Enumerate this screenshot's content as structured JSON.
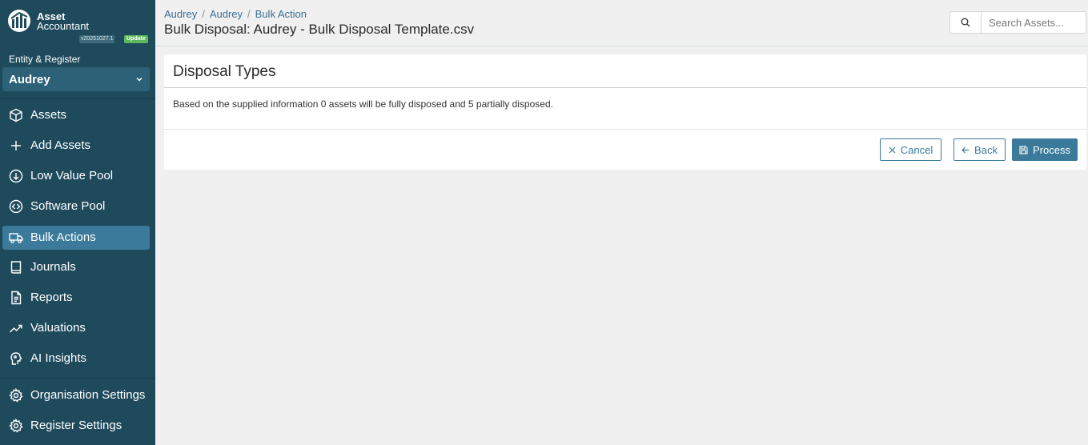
{
  "brand": {
    "name": "Asset",
    "subtitle": "Accountant",
    "version": "v20251027.1",
    "update_label": "Update"
  },
  "entity": {
    "label": "Entity & Register",
    "selected": "Audrey"
  },
  "nav": {
    "items": [
      {
        "label": "Assets",
        "icon": "cube-icon"
      },
      {
        "label": "Add Assets",
        "icon": "plus-icon"
      },
      {
        "label": "Low Value Pool",
        "icon": "arrow-down-circle-icon"
      },
      {
        "label": "Software Pool",
        "icon": "code-circle-icon"
      },
      {
        "label": "Bulk Actions",
        "icon": "truck-icon",
        "active": true
      },
      {
        "label": "Journals",
        "icon": "book-icon"
      },
      {
        "label": "Reports",
        "icon": "document-icon"
      },
      {
        "label": "Valuations",
        "icon": "trending-up-icon"
      },
      {
        "label": "AI Insights",
        "icon": "brain-icon"
      }
    ],
    "settings": [
      {
        "label": "Organisation Settings",
        "icon": "gear-icon"
      },
      {
        "label": "Register Settings",
        "icon": "gear-icon"
      }
    ]
  },
  "header": {
    "breadcrumbs": [
      "Audrey",
      "Audrey",
      "Bulk Action"
    ],
    "title": "Bulk Disposal: Audrey - Bulk Disposal Template.csv",
    "search_placeholder": "Search Assets..."
  },
  "card": {
    "title": "Disposal Types",
    "body": "Based on the supplied information 0 assets will be fully disposed and 5 partially disposed.",
    "cancel_label": "Cancel",
    "back_label": "Back",
    "process_label": "Process"
  },
  "colors": {
    "sidebar": "#1f4a5c",
    "accent": "#3b7a9a",
    "badge_update": "#5cb85c"
  }
}
